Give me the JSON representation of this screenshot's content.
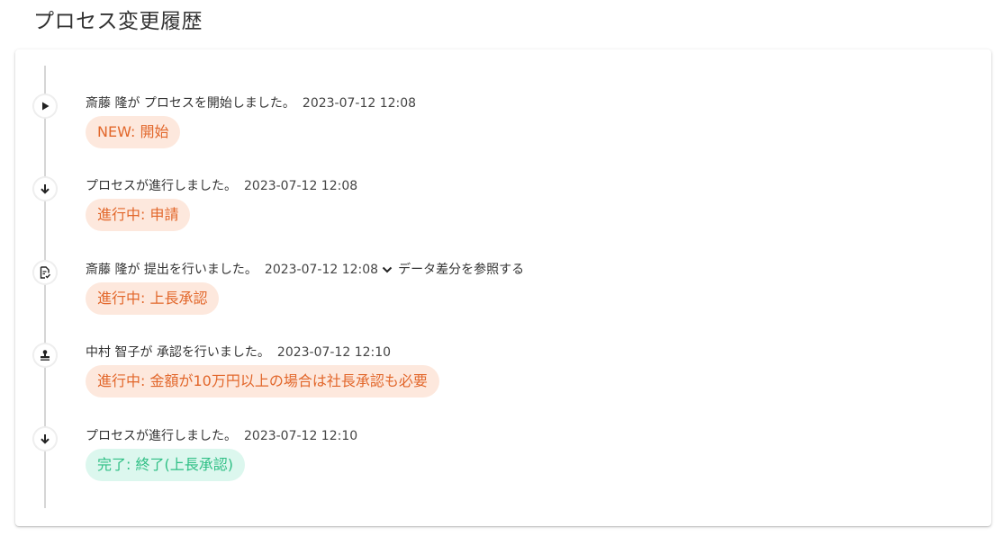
{
  "page": {
    "title": "プロセス変更履歴"
  },
  "colors": {
    "chip_orange_bg": "#fde8dd",
    "chip_orange_text": "#e2672b",
    "chip_green_bg": "#dcf7ee",
    "chip_green_text": "#2fbf85"
  },
  "history": [
    {
      "icon": "play-icon",
      "message": "斎藤 隆が プロセスを開始しました。",
      "timestamp": "2023-07-12 12:08",
      "status": "NEW: 開始",
      "status_color": "orange"
    },
    {
      "icon": "arrow-down-icon",
      "message": "プロセスが進行しました。",
      "timestamp": "2023-07-12 12:08",
      "status": "進行中: 申請",
      "status_color": "orange"
    },
    {
      "icon": "document-check-icon",
      "message": "斎藤 隆が 提出を行いました。",
      "timestamp": "2023-07-12 12:08",
      "diff_link": "データ差分を参照する",
      "status": "進行中: 上長承認",
      "status_color": "orange"
    },
    {
      "icon": "stamp-icon",
      "message": "中村 智子が 承認を行いました。",
      "timestamp": "2023-07-12 12:10",
      "status": "進行中: 金額が10万円以上の場合は社長承認も必要",
      "status_color": "orange"
    },
    {
      "icon": "arrow-down-icon",
      "message": "プロセスが進行しました。",
      "timestamp": "2023-07-12 12:10",
      "status": "完了: 終了(上長承認)",
      "status_color": "green"
    }
  ]
}
